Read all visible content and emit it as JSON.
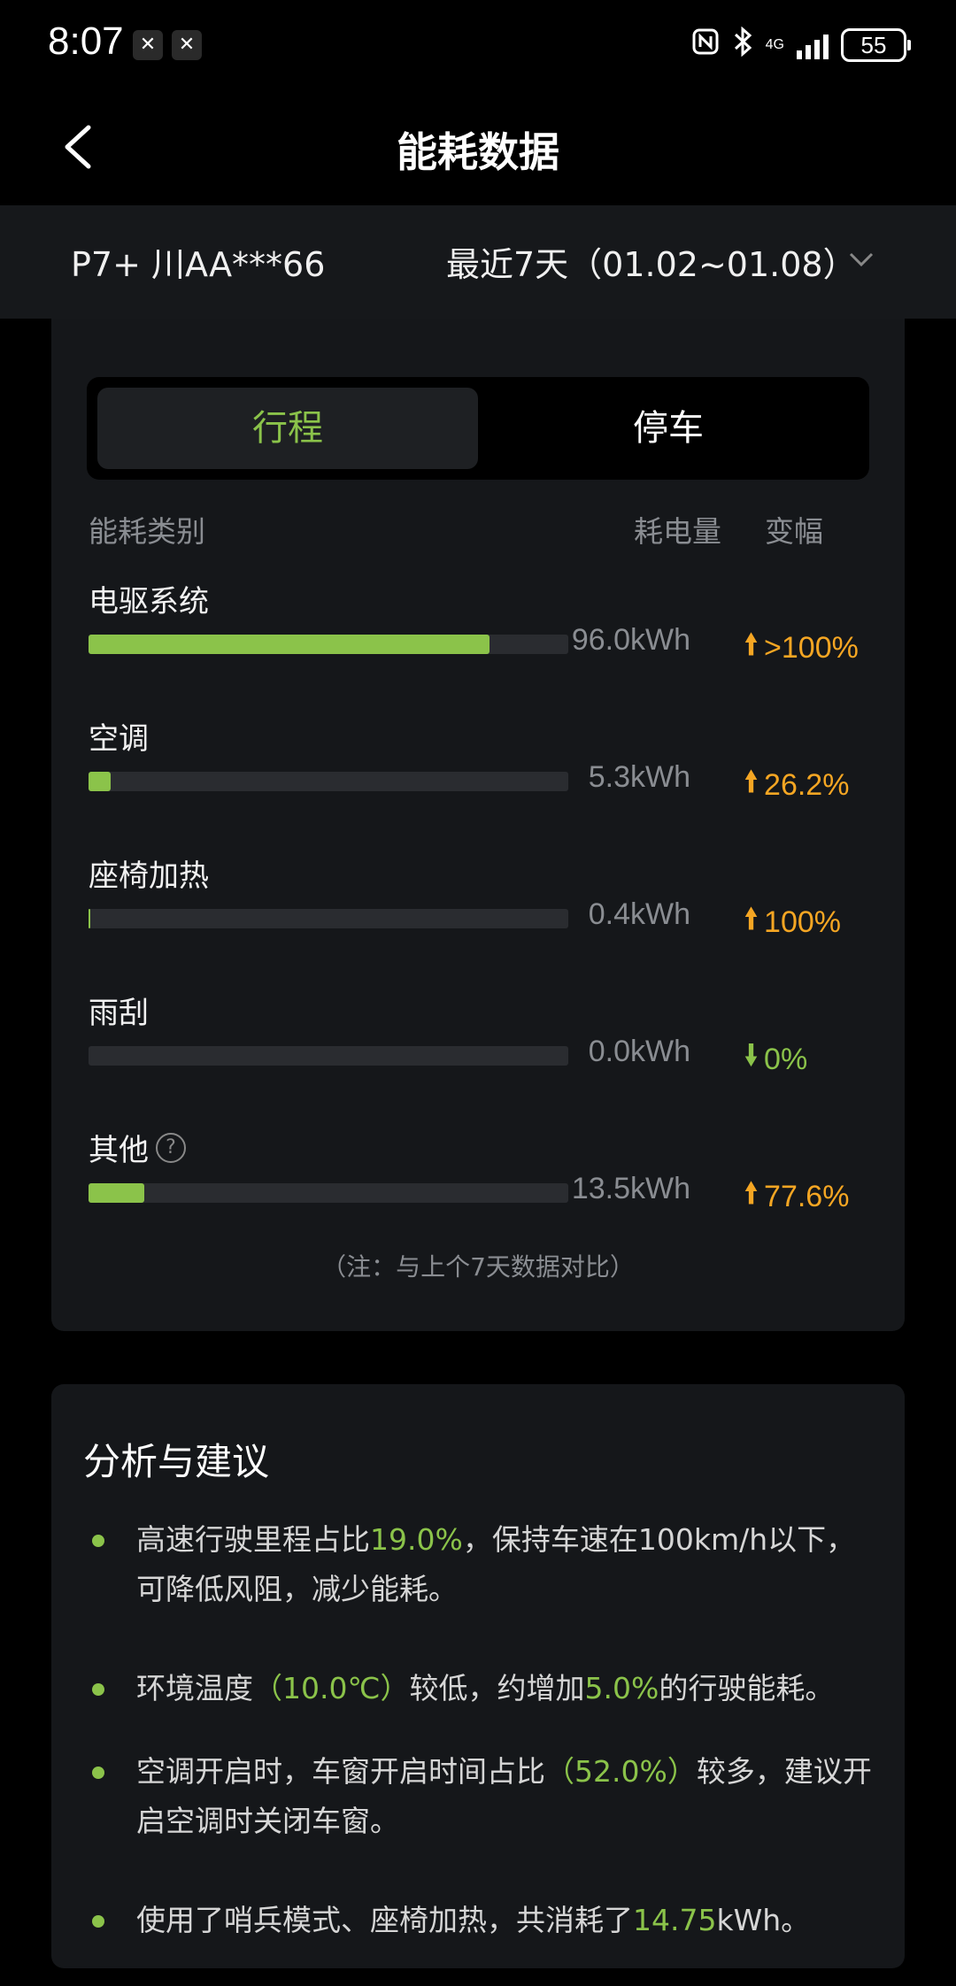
{
  "status_bar": {
    "time": "8:07",
    "network": "4G",
    "battery": "55"
  },
  "header": {
    "title": "能耗数据"
  },
  "filter": {
    "vehicle": "P7+ 川AA***66",
    "range": "最近7天（01.02~01.08）"
  },
  "tabs": [
    {
      "label": "行程",
      "active": true
    },
    {
      "label": "停车",
      "active": false
    }
  ],
  "columns": {
    "category": "能耗类别",
    "energy": "耗电量",
    "change": "变幅"
  },
  "rows": [
    {
      "label": "电驱系统",
      "energy": "96.0kWh",
      "change": ">100%",
      "direction": "up",
      "bar_ratio": 0.835
    },
    {
      "label": "空调",
      "energy": "5.3kWh",
      "change": "26.2%",
      "direction": "up",
      "bar_ratio": 0.046
    },
    {
      "label": "座椅加热",
      "energy": "0.4kWh",
      "change": "100%",
      "direction": "up",
      "bar_ratio": 0.004
    },
    {
      "label": "雨刮",
      "energy": "0.0kWh",
      "change": "0%",
      "direction": "down",
      "bar_ratio": 0.0
    },
    {
      "label": "其他",
      "energy": "13.5kWh",
      "change": "77.6%",
      "direction": "up",
      "bar_ratio": 0.117,
      "help": true
    }
  ],
  "note": "（注：与上个7天数据对比）",
  "analysis": {
    "title": "分析与建议",
    "items": [
      {
        "parts": [
          {
            "t": "高速行驶里程占比"
          },
          {
            "t": "19.0%",
            "hl": true
          },
          {
            "t": "，保持车速在100km/h以下，可降低风阻，减少能耗。"
          }
        ]
      },
      {
        "parts": [
          {
            "t": "环境温度"
          },
          {
            "t": "（10.0℃）",
            "hl": true
          },
          {
            "t": "较低，约增加"
          },
          {
            "t": "5.0%",
            "hl": true
          },
          {
            "t": "的行驶能耗。"
          }
        ]
      },
      {
        "parts": [
          {
            "t": "空调开启时，车窗开启时间占比"
          },
          {
            "t": "（52.0%）",
            "hl": true
          },
          {
            "t": "较多，建议开启空调时关闭车窗。"
          }
        ]
      },
      {
        "parts": [
          {
            "t": "使用了哨兵模式、座椅加热，共消耗了"
          },
          {
            "t": "14.75",
            "hl": true
          },
          {
            "t": "kWh。"
          }
        ]
      }
    ]
  },
  "colors": {
    "accent": "#8bc34a",
    "increase": "#f5a623",
    "background": "#000000",
    "card": "#15171a"
  },
  "icons": [
    "back-arrow-icon",
    "chevron-down-icon",
    "help-icon",
    "arrow-up-icon",
    "arrow-down-icon",
    "nfc-icon",
    "bluetooth-icon",
    "signal-icon",
    "battery-icon"
  ]
}
